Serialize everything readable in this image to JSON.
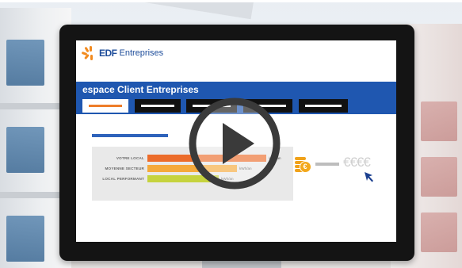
{
  "logo": {
    "brand": "EDF",
    "suffix": "Entreprises"
  },
  "header": {
    "title": "espace Client Entreprises"
  },
  "tabs": [
    {
      "label": "",
      "active": true
    },
    {
      "label": "",
      "active": false
    },
    {
      "label": "",
      "active": false
    },
    {
      "label": "",
      "active": false
    },
    {
      "label": "",
      "active": false
    }
  ],
  "comparison": {
    "rows": [
      {
        "label": "VOTRE LOCAL",
        "unit": "kWh/an",
        "color": "#ec6c2a",
        "level": 1.0
      },
      {
        "label": "MOYENNE SECTEUR",
        "unit": "kWh/an",
        "color": "#f5a93b",
        "level": 0.75
      },
      {
        "label": "LOCAL PERFORMANT",
        "unit": "kWh/an",
        "color": "#c6d33e",
        "level": 0.6
      }
    ]
  },
  "cost": {
    "coin_symbol": "€",
    "euros": "€€€€"
  },
  "colors": {
    "accent_blue": "#1f57b0",
    "accent_orange": "#ee7d2a"
  },
  "icons": [
    "play-icon",
    "coins-icon",
    "cursor-arrow-icon",
    "edf-logo-icon"
  ]
}
